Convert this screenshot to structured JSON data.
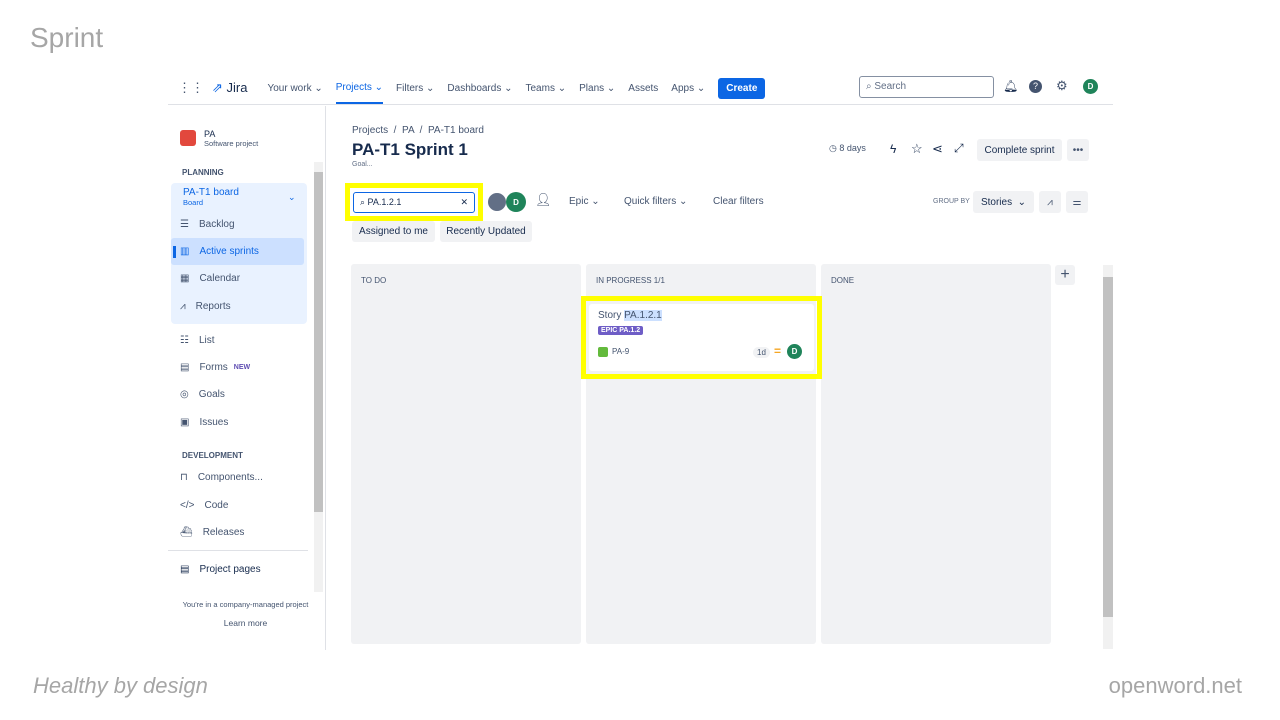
{
  "slide": {
    "title": "Sprint",
    "footer_left": "Healthy by design",
    "footer_right": "openword.net"
  },
  "nav": {
    "app": "Jira",
    "items": [
      "Your work ⌄",
      "Projects ⌄",
      "Filters ⌄",
      "Dashboards ⌄",
      "Teams ⌄",
      "Plans ⌄",
      "Assets",
      "Apps ⌄"
    ],
    "create": "Create",
    "search_placeholder": "Search",
    "avatar": "D"
  },
  "sidebar": {
    "project": "PA",
    "project_type": "Software project",
    "planning": "PLANNING",
    "board": "PA-T1 board",
    "board_sub": "Board",
    "planning_items": [
      "Backlog",
      "Active sprints",
      "Calendar",
      "Reports"
    ],
    "items": [
      "List",
      "Forms",
      "Goals",
      "Issues"
    ],
    "forms_badge": "NEW",
    "development": "DEVELOPMENT",
    "dev_items": [
      "Components...",
      "Code",
      "Releases"
    ],
    "project_pages": "Project pages",
    "note": "You're in a company-managed project",
    "learn_more": "Learn more"
  },
  "main": {
    "breadcrumb": [
      "Projects",
      "PA",
      "PA-T1 board"
    ],
    "title": "PA-T1 Sprint 1",
    "goal": "Goal...",
    "days": "8 days",
    "complete_sprint": "Complete sprint",
    "search_value": "PA.1.2.1",
    "avatar": "D",
    "epic": "Epic",
    "quick_filters": "Quick filters",
    "clear_filters": "Clear filters",
    "group_by": "GROUP BY",
    "group_value": "Stories",
    "chips": [
      "Assigned to me",
      "Recently Updated"
    ],
    "columns": [
      "TO DO",
      "IN PROGRESS 1/1",
      "DONE"
    ],
    "card": {
      "title_prefix": "Story ",
      "title_match": "PA.1.2.1",
      "epic": "EPIC PA.1.2",
      "key": "PA-9",
      "estimate": "1d",
      "assignee": "D"
    }
  },
  "colors": {
    "accent": "#0c66e4",
    "highlight": "#ffff00",
    "epic": "#6e5dc6",
    "avatar": "#1f845a"
  }
}
